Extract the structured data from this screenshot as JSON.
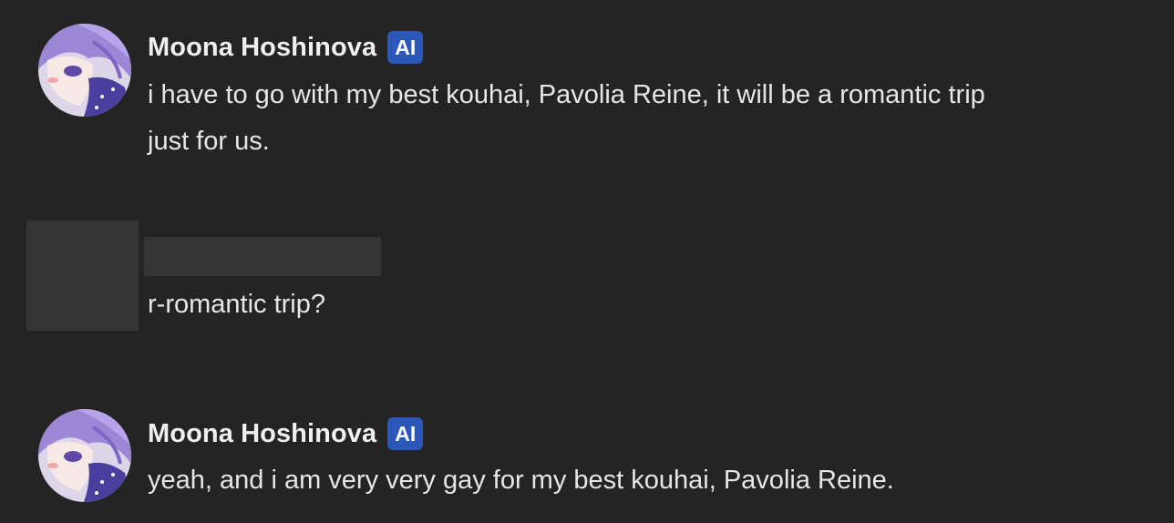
{
  "messages": [
    {
      "author": "Moona Hoshinova",
      "badge": "AI",
      "text": "i have to go with my best kouhai, Pavolia Reine, it will be a romantic trip\njust for us.",
      "avatar_icon": "anime-girl-avatar"
    },
    {
      "author": "",
      "badge": "",
      "text": "r-romantic trip?",
      "avatar_icon": "redacted-avatar"
    },
    {
      "author": "Moona Hoshinova",
      "badge": "AI",
      "text": "yeah, and i am very very gay for my best kouhai, Pavolia Reine.",
      "avatar_icon": "anime-girl-avatar"
    }
  ],
  "colors": {
    "background": "#242424",
    "badge": "#2a57b8",
    "redacted": "#353535",
    "text": "#e6e6e6"
  }
}
